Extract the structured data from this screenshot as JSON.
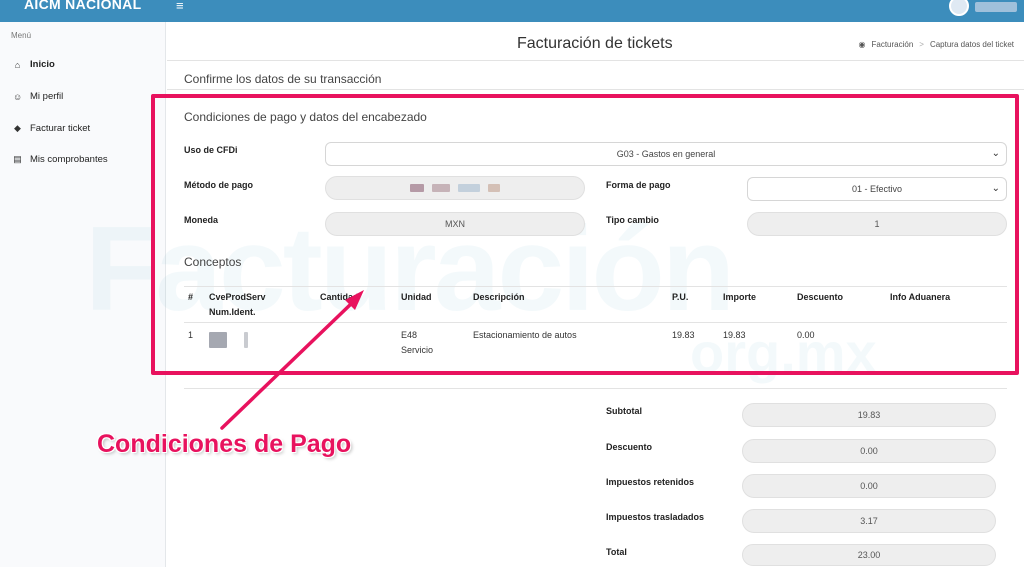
{
  "app": {
    "brand": "AICM NACIONAL"
  },
  "sidebar": {
    "header": "Menú",
    "items": [
      {
        "label": "Inicio",
        "icon": "home-icon"
      },
      {
        "label": "Mi perfil",
        "icon": "smiley-icon"
      },
      {
        "label": "Facturar ticket",
        "icon": "ticket-icon"
      },
      {
        "label": "Mis comprobantes",
        "icon": "list-icon"
      }
    ]
  },
  "header": {
    "title": "Facturación de tickets",
    "breadcrumb": [
      "Facturación",
      "Captura datos del ticket"
    ]
  },
  "main": {
    "confirm_title": "Confirme los datos de su transacción",
    "section_title": "Condiciones de pago y datos del encabezado",
    "fields": {
      "uso_cfdi_label": "Uso de CFDi",
      "uso_cfdi_value": "G03 - Gastos en general",
      "metodo_pago_label": "Método de pago",
      "forma_pago_label": "Forma de pago",
      "forma_pago_value": "01 - Efectivo",
      "moneda_label": "Moneda",
      "moneda_value": "MXN",
      "tipo_cambio_label": "Tipo cambio",
      "tipo_cambio_value": "1"
    },
    "conceptos_title": "Conceptos",
    "table": {
      "headers": [
        "#",
        "CveProdServ",
        "Num.Ident.",
        "Cantidad",
        "Unidad",
        "Descripción",
        "P.U.",
        "Importe",
        "Descuento",
        "Info Aduanera"
      ],
      "rows": [
        {
          "num": "1",
          "unidad": "E48",
          "unidad2": "Servicio",
          "descripcion": "Estacionamiento de autos",
          "pu": "19.83",
          "importe": "19.83",
          "descuento": "0.00"
        }
      ]
    },
    "totals": [
      {
        "label": "Subtotal",
        "value": "19.83"
      },
      {
        "label": "Descuento",
        "value": "0.00"
      },
      {
        "label": "Impuestos retenidos",
        "value": "0.00"
      },
      {
        "label": "Impuestos trasladados",
        "value": "3.17"
      },
      {
        "label": "Total",
        "value": "23.00"
      }
    ]
  },
  "overlay": {
    "watermark": "Facturación",
    "watermark_suffix": "org.mx",
    "annotation": "Condiciones de Pago",
    "accent_color": "#e8125e"
  }
}
